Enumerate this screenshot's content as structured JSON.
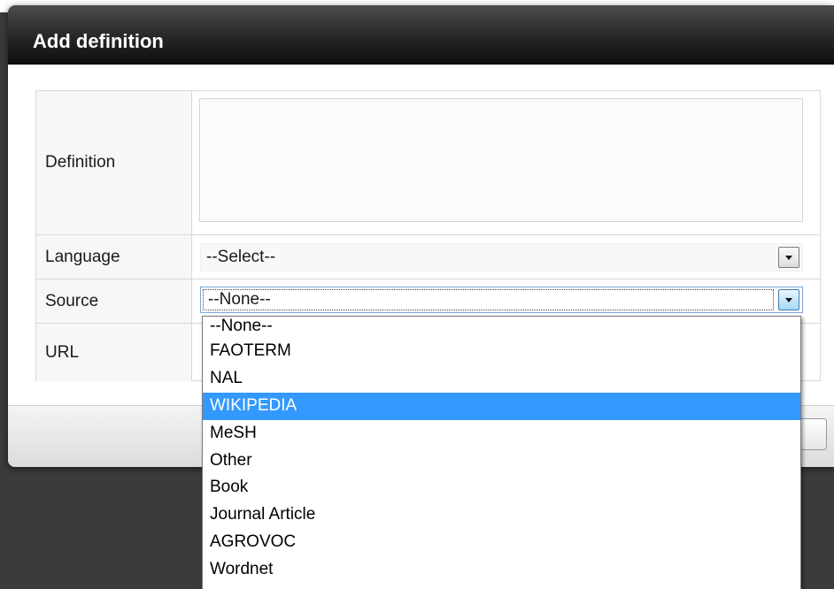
{
  "dialog": {
    "title": "Add definition"
  },
  "form": {
    "definition_label": "Definition",
    "definition_value": "",
    "language_label": "Language",
    "language_value": "--Select--",
    "source_label": "Source",
    "source_value": "--None--",
    "url_label": "URL"
  },
  "source_dropdown": {
    "selected_index": 3,
    "options": [
      "--None--",
      "FAOTERM",
      "NAL",
      "WIKIPEDIA",
      "MeSH",
      "Other",
      "Book",
      "Journal Article",
      "AGROVOC",
      "Wordnet"
    ]
  },
  "icons": {
    "dropdown_arrow": "chevron-down-icon",
    "resize_grip": "resize-grip-icon"
  },
  "colors": {
    "header_dark": "#0e0e0e",
    "selection_blue": "#3399ff",
    "backdrop": "#3b3b3b"
  }
}
